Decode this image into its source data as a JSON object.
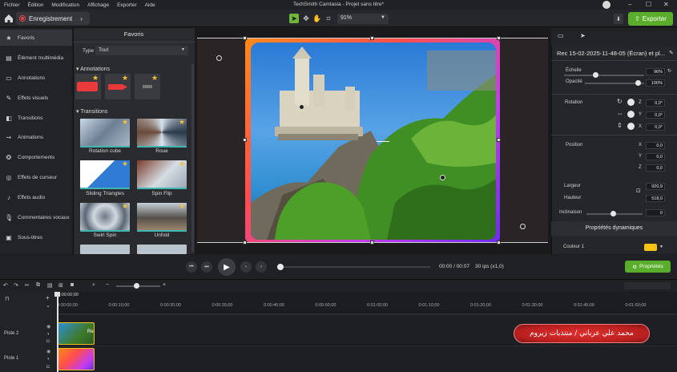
{
  "menu": [
    "Fichier",
    "Édition",
    "Modification",
    "Affichage",
    "Exporter",
    "Aide"
  ],
  "app_title": "TechSmith Camtasia - Projet sans titre*",
  "toolbar": {
    "record_label": "Enregistrement",
    "zoom": "91%",
    "export_label": "Exporter"
  },
  "leftnav": [
    {
      "label": "Favoris",
      "icon": "star-icon"
    },
    {
      "label": "Élément multimédia",
      "icon": "media-icon"
    },
    {
      "label": "Annotations",
      "icon": "annotation-icon"
    },
    {
      "label": "Effets visuels",
      "icon": "visual-effects-icon"
    },
    {
      "label": "Transitions",
      "icon": "transitions-icon"
    },
    {
      "label": "Animations",
      "icon": "animations-icon"
    },
    {
      "label": "Comportements",
      "icon": "behaviors-icon"
    },
    {
      "label": "Effets de curseur",
      "icon": "cursor-effects-icon"
    },
    {
      "label": "Effets audio",
      "icon": "audio-effects-icon"
    },
    {
      "label": "Commentaires vocaux",
      "icon": "voice-narration-icon"
    },
    {
      "label": "Sous-titres",
      "icon": "captions-icon"
    }
  ],
  "favorites": {
    "title": "Favoris",
    "type_label": "Type",
    "type_value": "Tout",
    "annotations_header": "Annotations",
    "transitions_header": "Transitions",
    "transitions": [
      "Rotation cube",
      "Roue",
      "Sliding Triangles",
      "Spin Flip",
      "Swirl Spin",
      "Unfold"
    ]
  },
  "playback": {
    "time": "00:00 / 00:07",
    "fps": "30 ips (x1,0)"
  },
  "properties": {
    "media_title": "Rec 15-02-2025-11-48-05 (Écran) et pl...",
    "scale_label": "Échelle",
    "scale_value": "96%",
    "opacity_label": "Opacité",
    "opacity_value": "100%",
    "rotation_label": "Rotation",
    "rot_z": "0,0°",
    "rot_y": "0,0°",
    "rot_x": "0,0°",
    "position_label": "Position",
    "pos_x": "0,0",
    "pos_y": "0,0",
    "pos_z": "0,0",
    "width_label": "Largeur",
    "width_value": "920,9",
    "height_label": "Hauteur",
    "height_value": "518,0",
    "skew_label": "Inclinaison",
    "skew_value": "0",
    "dynamic_header": "Propriétés dynamiques",
    "color_label": "Couleur 1",
    "color_value": "#f5c318",
    "props_button": "Propriétés"
  },
  "timeline": {
    "current_time": "0:00:00;00",
    "ticks": [
      "0:00:00;00",
      "0:00:10;00",
      "0:00:20;00",
      "0:00:30;00",
      "0:00:40;00",
      "0:00:50;00",
      "0:01:00;00",
      "0:01:10;00",
      "0:01:20;00",
      "0:01:30;00",
      "0:01:40;00",
      "0:01:50;00"
    ],
    "tracks": [
      "Piste 2",
      "Piste 1"
    ],
    "clip2_label": "Re"
  },
  "watermark_text": "محمد علي عرباني / منتديات زيروم"
}
